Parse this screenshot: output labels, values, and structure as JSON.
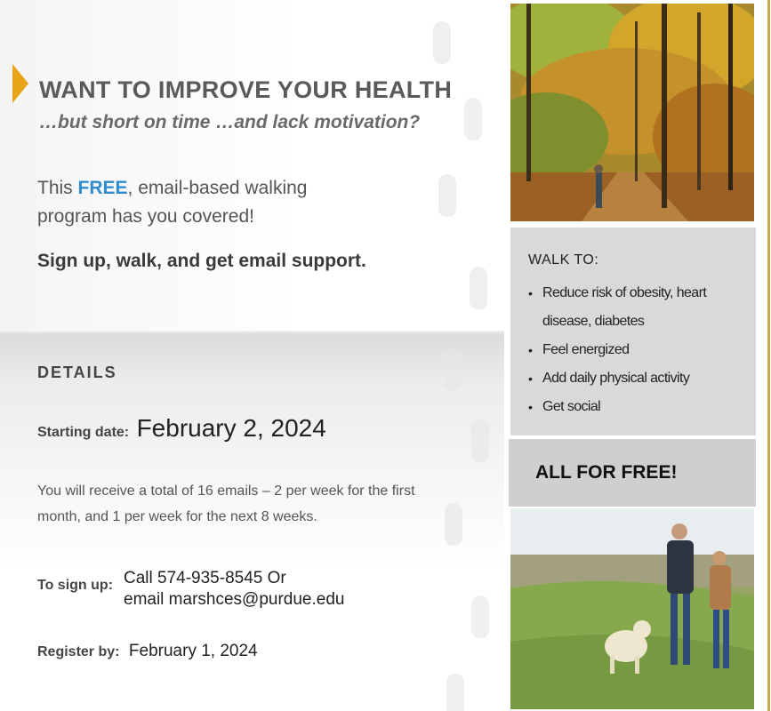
{
  "headline": "WANT TO IMPROVE YOUR HEALTH",
  "subheadline": "…but short on time …and lack motivation?",
  "intro": {
    "prefix": "This ",
    "free": "FREE",
    "rest": ", email-based walking program has you covered!"
  },
  "signup_line": "Sign up, walk, and get email support.",
  "details": {
    "title": "DETAILS",
    "starting_label": "Starting date:",
    "starting_value": "February 2, 2024",
    "emails_text": "You will receive a total of 16 emails – 2 per week for the first month, and 1 per week for the next 8 weeks.",
    "signup_label": "To sign up:",
    "signup_line1": "Call 574-935-8545 Or",
    "signup_line2": "email marshces@purdue.edu",
    "register_label": "Register by:",
    "register_value": "February 1, 2024"
  },
  "walk_to": {
    "title": "WALK TO:",
    "items": [
      "Reduce risk of obesity, heart disease, diabetes",
      "Feel energized",
      "Add daily physical activity",
      "Get social"
    ]
  },
  "free_banner": "ALL FOR FREE!",
  "colors": {
    "accent_arrow": "#e9a417",
    "free_blue": "#2e8ccf",
    "gold_border": "#c9a84f"
  }
}
